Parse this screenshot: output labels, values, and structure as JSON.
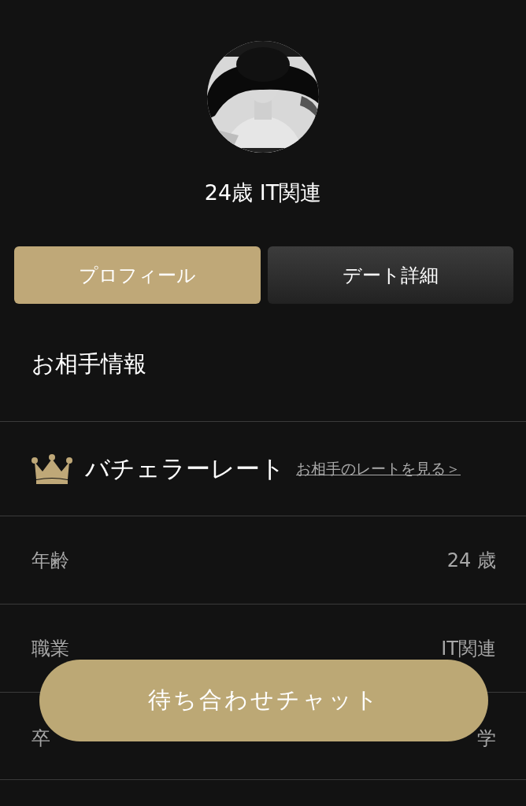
{
  "profile": {
    "headline": "24歳 IT関連"
  },
  "tabs": [
    {
      "label": "プロフィール",
      "selected": true
    },
    {
      "label": "デート詳細",
      "selected": false
    }
  ],
  "section_title": "お相手情報",
  "rate": {
    "label": "バチェラーレート",
    "link": "お相手のレートを見る＞"
  },
  "details": [
    {
      "label": "年齢",
      "value": "24 歳"
    },
    {
      "label": "職業",
      "value": "IT関連"
    },
    {
      "label": "卒",
      "value": "学"
    }
  ],
  "chat_button": "待ち合わせチャット"
}
